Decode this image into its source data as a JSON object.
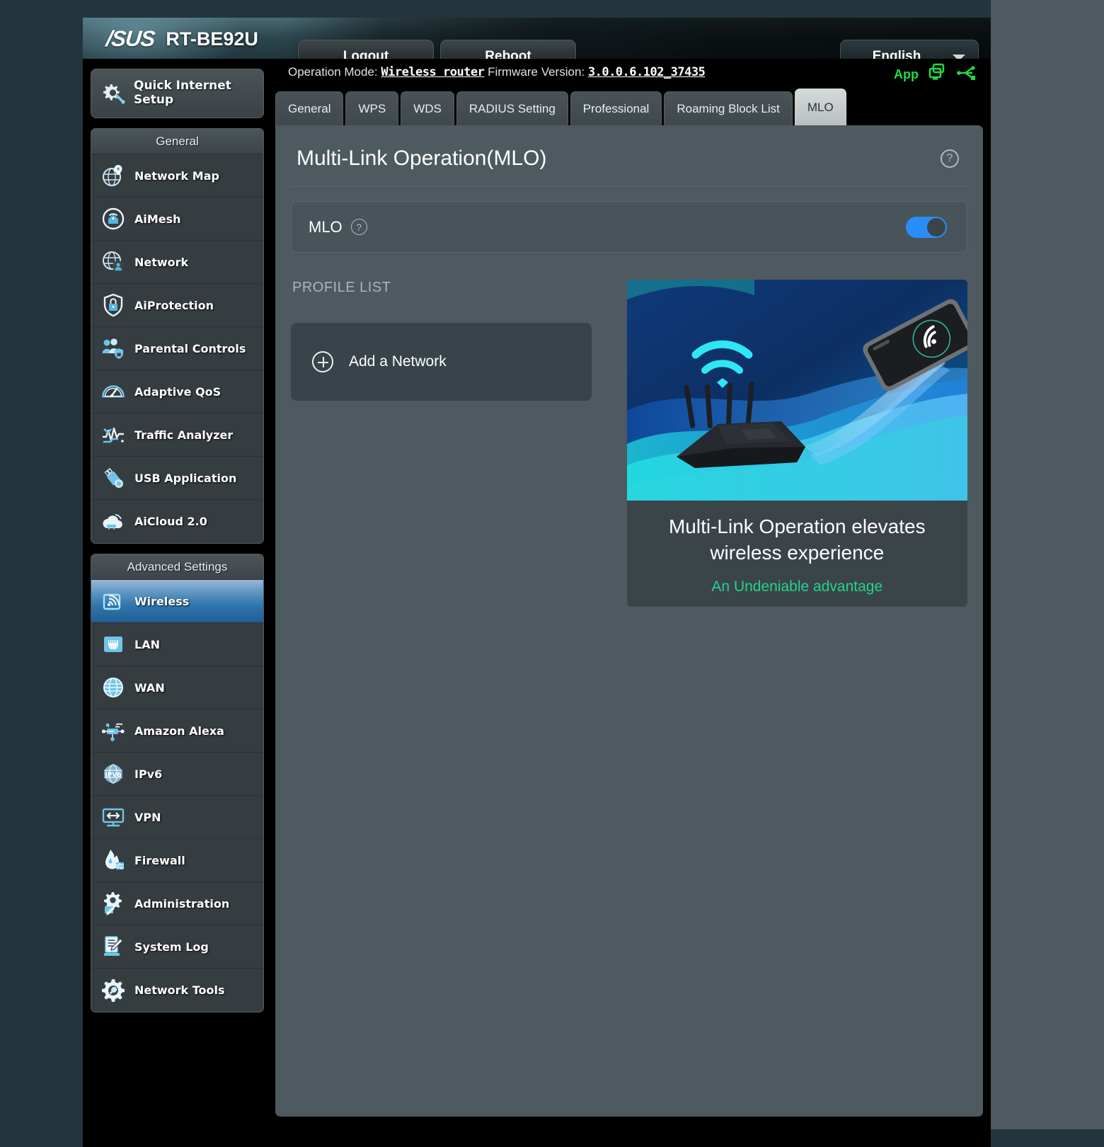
{
  "header": {
    "brand": "/SUS",
    "model": "RT-BE92U",
    "logout_label": "Logout",
    "reboot_label": "Reboot",
    "language": "English",
    "accent_green": "#1fdb45"
  },
  "status": {
    "operation_mode_label": "Operation Mode:",
    "operation_mode_value": "Wireless router",
    "firmware_label": "Firmware Version:",
    "firmware_value": "3.0.0.6.102_37435",
    "app_label": "App"
  },
  "sidebar": {
    "quick_setup": "Quick Internet Setup",
    "general_title": "General",
    "general_items": [
      {
        "label": "Network Map",
        "icon": "network-map-icon"
      },
      {
        "label": "AiMesh",
        "icon": "aimesh-icon"
      },
      {
        "label": "Network",
        "icon": "network-icon"
      },
      {
        "label": "AiProtection",
        "icon": "shield-lock-icon"
      },
      {
        "label": "Parental Controls",
        "icon": "parental-controls-icon"
      },
      {
        "label": "Adaptive QoS",
        "icon": "gauge-icon"
      },
      {
        "label": "Traffic Analyzer",
        "icon": "traffic-analyzer-icon"
      },
      {
        "label": "USB Application",
        "icon": "usb-icon"
      },
      {
        "label": "AiCloud 2.0",
        "icon": "cloud-icon"
      }
    ],
    "advanced_title": "Advanced Settings",
    "advanced_items": [
      {
        "label": "Wireless",
        "icon": "wireless-icon",
        "active": true
      },
      {
        "label": "LAN",
        "icon": "lan-port-icon",
        "active": false
      },
      {
        "label": "WAN",
        "icon": "globe-icon",
        "active": false
      },
      {
        "label": "Amazon Alexa",
        "icon": "alexa-icon",
        "active": false
      },
      {
        "label": "IPv6",
        "icon": "ipv6-icon",
        "active": false
      },
      {
        "label": "VPN",
        "icon": "vpn-icon",
        "active": false
      },
      {
        "label": "Firewall",
        "icon": "firewall-icon",
        "active": false
      },
      {
        "label": "Administration",
        "icon": "gear-pencil-icon",
        "active": false
      },
      {
        "label": "System Log",
        "icon": "system-log-icon",
        "active": false
      },
      {
        "label": "Network Tools",
        "icon": "gear-wrench-icon",
        "active": false
      }
    ]
  },
  "tabs": [
    {
      "label": "General",
      "active": false
    },
    {
      "label": "WPS",
      "active": false
    },
    {
      "label": "WDS",
      "active": false
    },
    {
      "label": "RADIUS Setting",
      "active": false
    },
    {
      "label": "Professional",
      "active": false
    },
    {
      "label": "Roaming Block List",
      "active": false
    },
    {
      "label": "MLO",
      "active": true
    }
  ],
  "panel": {
    "title": "Multi-Link Operation(MLO)",
    "help_glyph": "?",
    "mlo_label": "MLO",
    "mlo_enabled": true,
    "profile_list_title": "PROFILE LIST",
    "add_network_label": "Add a Network"
  },
  "promo": {
    "headline": "Multi-Link Operation elevates wireless experience",
    "subline": "An Undeniable advantage",
    "accent": "#21d38f"
  }
}
